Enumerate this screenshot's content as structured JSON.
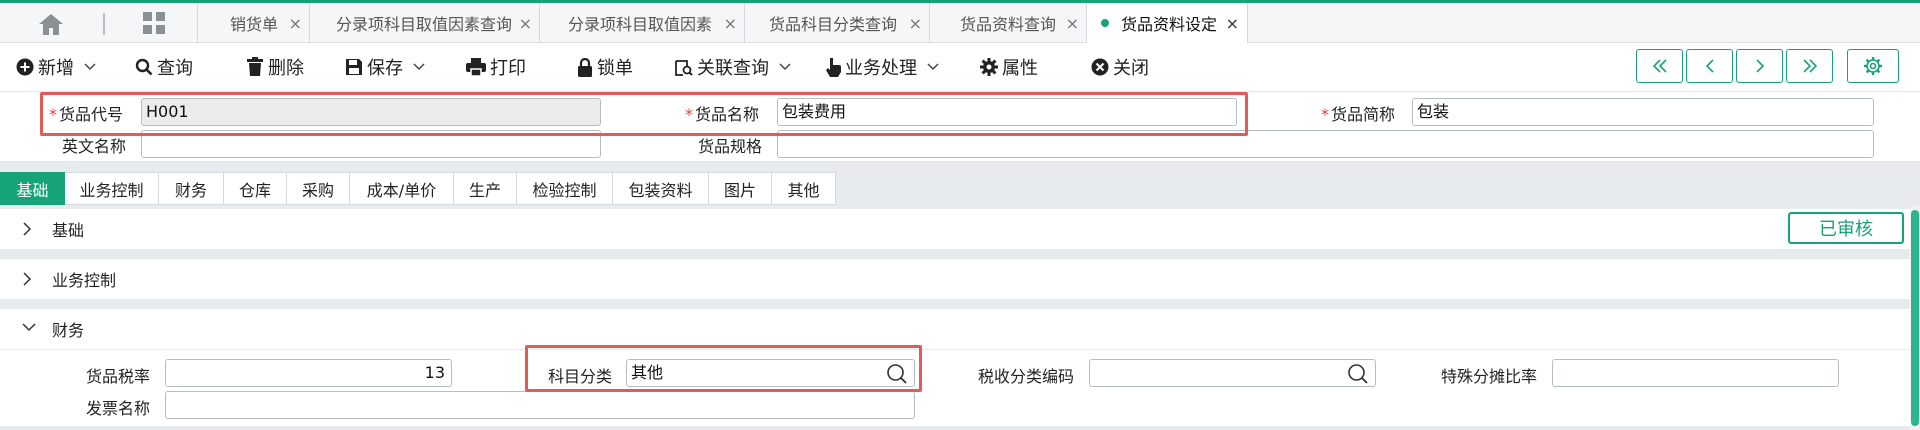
{
  "tabs": [
    {
      "label": "销货单",
      "close": "×"
    },
    {
      "label": "分录项科目取值因素查询",
      "close": "×"
    },
    {
      "label": "分录项科目取值因素",
      "close": "×"
    },
    {
      "label": "货品科目分类查询",
      "close": "×"
    },
    {
      "label": "货品资料查询",
      "close": "×"
    },
    {
      "label": "货品资料设定",
      "close": "×",
      "active": true
    }
  ],
  "toolbar": {
    "add": "新增",
    "query": "查询",
    "delete": "删除",
    "save": "保存",
    "print": "打印",
    "lock": "锁单",
    "related_query": "关联查询",
    "business": "业务处理",
    "properties": "属性",
    "close": "关闭"
  },
  "header": {
    "code_label": "货品代号",
    "code_value": "H001",
    "name_label": "货品名称",
    "name_value": "包装费用",
    "short_label": "货品简称",
    "short_value": "包装",
    "english_label": "英文名称",
    "english_value": "",
    "spec_label": "货品规格",
    "spec_value": "",
    "required_mark": "*"
  },
  "section_tabs": [
    "基础",
    "业务控制",
    "财务",
    "仓库",
    "采购",
    "成本/单价",
    "生产",
    "检验控制",
    "包装资料",
    "图片",
    "其他"
  ],
  "sections": {
    "basic": "基础",
    "business_control": "业务控制",
    "finance": "财务"
  },
  "status_badge": "已审核",
  "finance": {
    "tax_rate_label": "货品税率",
    "tax_rate_value": "13",
    "subject_category_label": "科目分类",
    "subject_category_value": "其他",
    "tax_code_label": "税收分类编码",
    "tax_code_value": "",
    "special_ratio_label": "特殊分摊比率",
    "special_ratio_value": "",
    "invoice_name_label": "发票名称",
    "invoice_name_value": ""
  },
  "colors": {
    "accent": "#16a37a",
    "highlight": "#e35a5a"
  }
}
